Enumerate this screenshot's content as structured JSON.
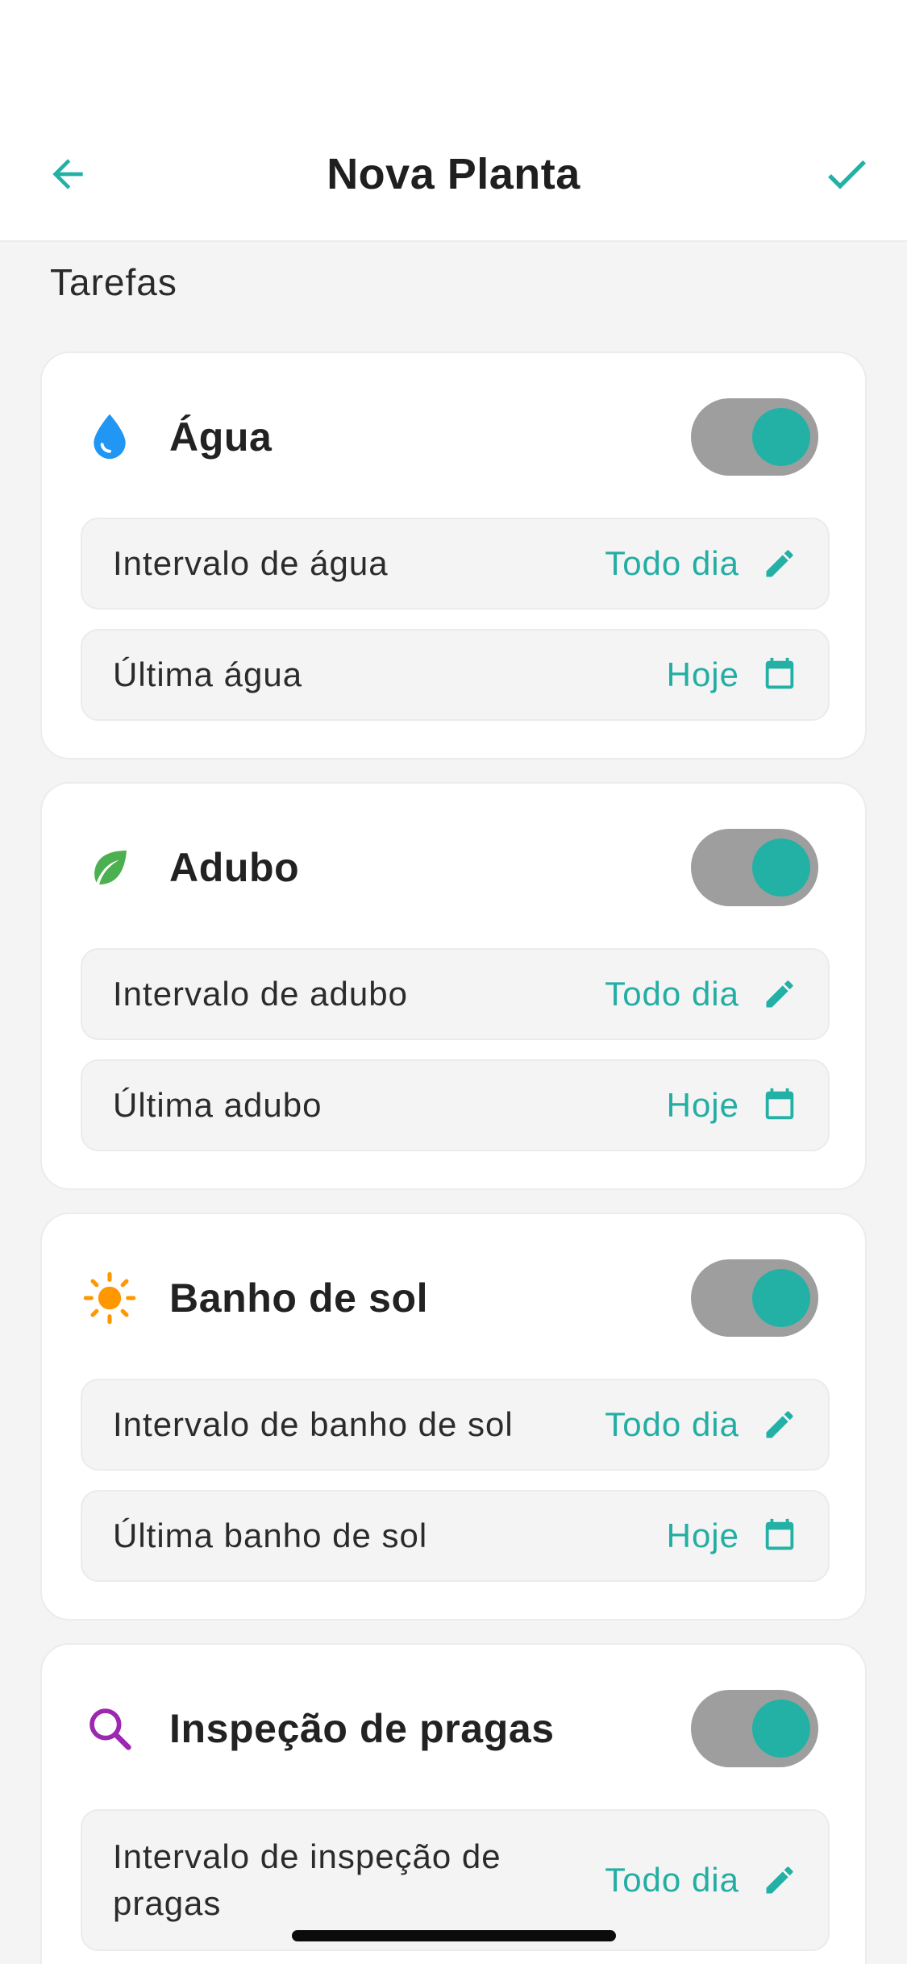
{
  "header": {
    "title": "Nova Planta",
    "back_icon": "arrow-left-icon",
    "confirm_icon": "check-icon"
  },
  "section": {
    "title": "Tarefas"
  },
  "colors": {
    "accent": "#23b1a5",
    "toggle_track": "#9e9e9e",
    "water": "#2196f3",
    "fertilizer": "#4caf50",
    "sun": "#ff9800",
    "pest": "#9c27b0"
  },
  "tasks": [
    {
      "name": "Água",
      "icon": "water-drop-icon",
      "enabled": true,
      "interval_label": "Intervalo de água",
      "interval_value": "Todo dia",
      "last_label": "Última água",
      "last_value": "Hoje"
    },
    {
      "name": "Adubo",
      "icon": "leaf-icon",
      "enabled": true,
      "interval_label": "Intervalo de adubo",
      "interval_value": "Todo dia",
      "last_label": "Última adubo",
      "last_value": "Hoje"
    },
    {
      "name": "Banho de sol",
      "icon": "sun-icon",
      "enabled": true,
      "interval_label": "Intervalo de banho de sol",
      "interval_value": "Todo dia",
      "last_label": "Última banho de sol",
      "last_value": "Hoje"
    },
    {
      "name": "Inspeção de pragas",
      "icon": "search-icon",
      "enabled": true,
      "interval_label": "Intervalo de inspeção de pragas",
      "interval_value": "Todo dia"
    }
  ]
}
